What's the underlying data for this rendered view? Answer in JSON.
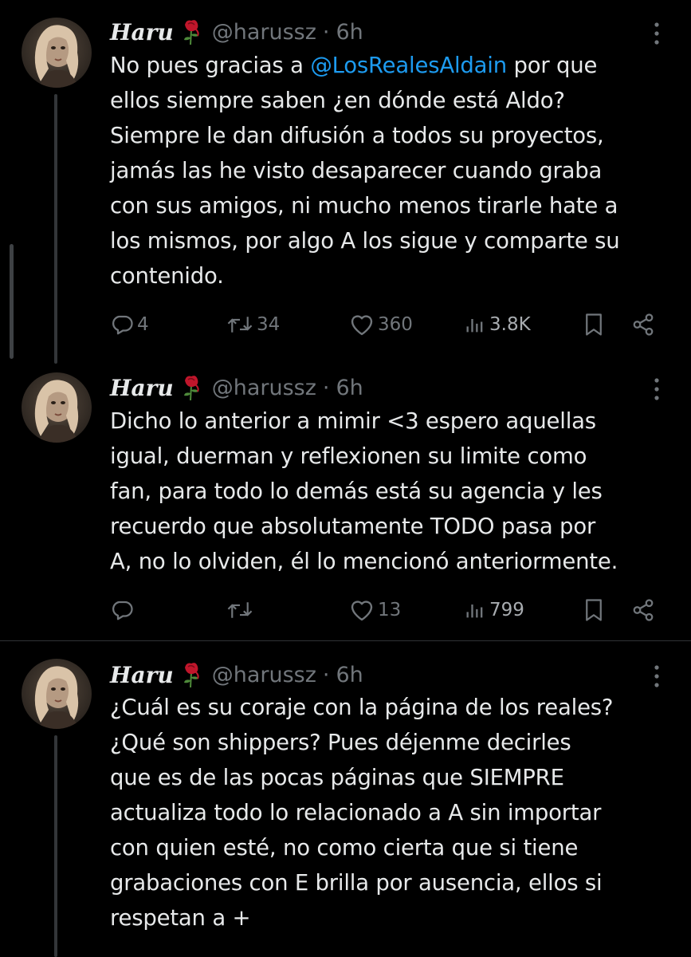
{
  "tweets": [
    {
      "name": "Haru",
      "handle": "@harussz",
      "dot": "·",
      "time": "6h",
      "lines": [
        [
          "No pues gracias a ",
          "@LosRealesAldain",
          " por que"
        ],
        [
          "ellos siempre saben ¿en dónde está Aldo?"
        ],
        [
          "Siempre le dan difusión a todos su proyectos,"
        ],
        [
          "jamás las he visto desaparecer cuando graba"
        ],
        [
          "con sus amigos, ni mucho menos tirarle hate a"
        ],
        [
          "los mismos, por algo A los sigue y comparte su"
        ],
        [
          "contenido."
        ]
      ],
      "replies": "4",
      "retweets": "34",
      "likes": "360",
      "views": "3.8K"
    },
    {
      "name": "Haru",
      "handle": "@harussz",
      "dot": "·",
      "time": "6h",
      "lines": [
        [
          "Dicho lo anterior a mimir <3 espero aquellas"
        ],
        [
          "igual, duerman y reflexionen su limite como"
        ],
        [
          "fan, para todo lo demás está su agencia y les"
        ],
        [
          "recuerdo que absolutamente TODO pasa por"
        ],
        [
          "A, no lo olviden, él lo mencionó anteriormente."
        ]
      ],
      "replies": "",
      "retweets": "",
      "likes": "13",
      "views": "799"
    },
    {
      "name": "Haru",
      "handle": "@harussz",
      "dot": "·",
      "time": "6h",
      "lines": [
        [
          "¿Cuál es su coraje con la página de los reales?"
        ],
        [
          "¿Qué son shippers? Pues déjenme decirles"
        ],
        [
          "que es de las pocas páginas que SIEMPRE"
        ],
        [
          "actualiza todo lo relacionado a A sin importar"
        ],
        [
          "con quien esté, no como cierta que si tiene"
        ],
        [
          "grabaciones con E brilla por ausencia, ellos si"
        ],
        [
          "respetan a +"
        ]
      ]
    }
  ],
  "icons": {
    "name_emoji": "wilted-rose-icon",
    "more": "more-vertical-icon",
    "reply": "reply-icon",
    "retweet": "retweet-icon",
    "like": "heart-icon",
    "views": "views-icon",
    "bookmark": "bookmark-icon",
    "share": "share-icon"
  },
  "colors": {
    "background": "#000000",
    "text": "#e7e9ea",
    "muted": "#71767b",
    "mention": "#1d9bf0",
    "divider": "#2f3336"
  }
}
